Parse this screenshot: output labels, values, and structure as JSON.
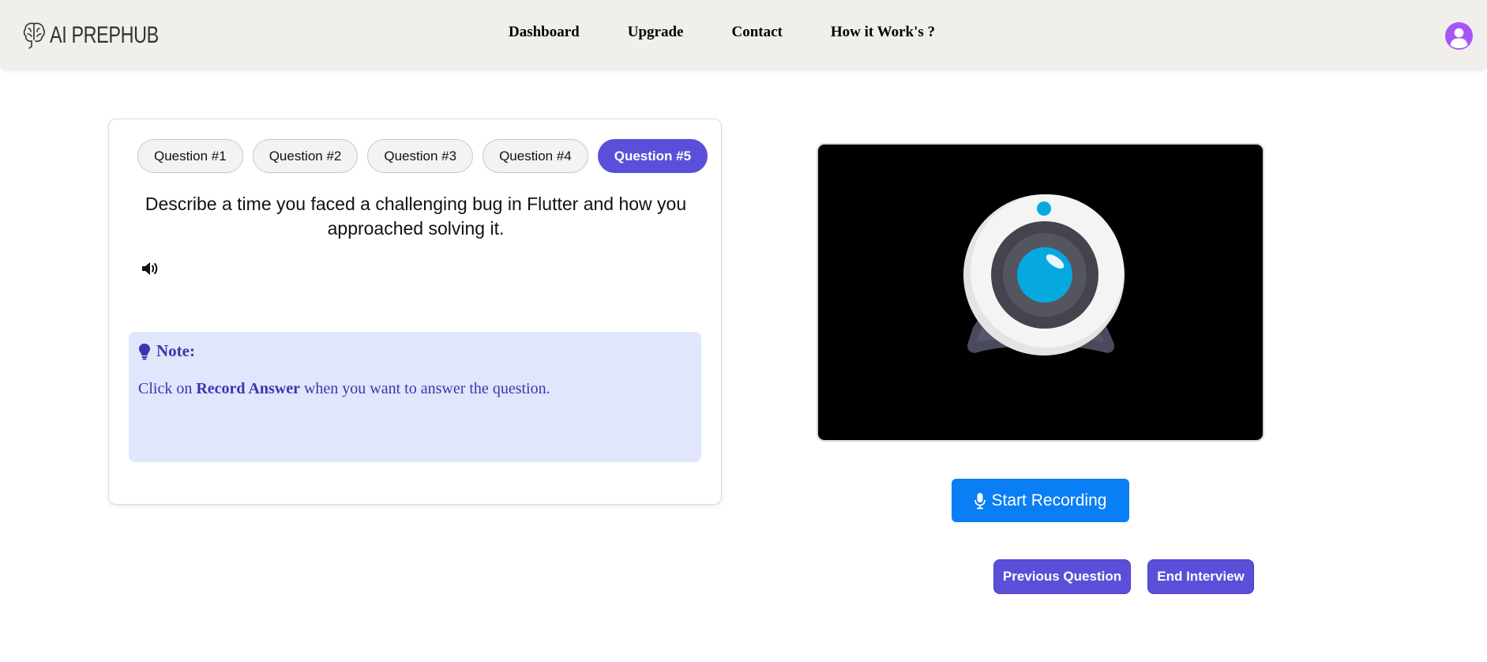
{
  "brand": {
    "name": "AI PREPHUB",
    "icon": "brain-icon"
  },
  "nav": {
    "items": [
      {
        "label": "Dashboard"
      },
      {
        "label": "Upgrade"
      },
      {
        "label": "Contact"
      },
      {
        "label": "How it Work's ?"
      }
    ]
  },
  "user": {
    "icon": "user-avatar-icon",
    "color": "#a855f7"
  },
  "questions": {
    "tabs": [
      {
        "label": "Question #1",
        "active": false
      },
      {
        "label": "Question #2",
        "active": false
      },
      {
        "label": "Question #3",
        "active": false
      },
      {
        "label": "Question #4",
        "active": false
      },
      {
        "label": "Question #5",
        "active": true
      }
    ],
    "current_text": "Describe a time you faced a challenging bug in Flutter and how you approached solving it.",
    "audio_icon": "speaker-icon"
  },
  "note": {
    "title": "Note:",
    "text_before": "Click on ",
    "text_bold": "Record Answer",
    "text_after": " when you want to answer the question.",
    "icon": "lightbulb-icon"
  },
  "video": {
    "placeholder_icon": "webcam-icon"
  },
  "actions": {
    "start_recording": "Start Recording",
    "previous_question": "Previous Question",
    "end_interview": "End Interview"
  },
  "colors": {
    "accent": "#5b4fd9",
    "record": "#0a7ef4",
    "note_bg": "#e0e6fb",
    "header_bg": "#f1efec"
  }
}
